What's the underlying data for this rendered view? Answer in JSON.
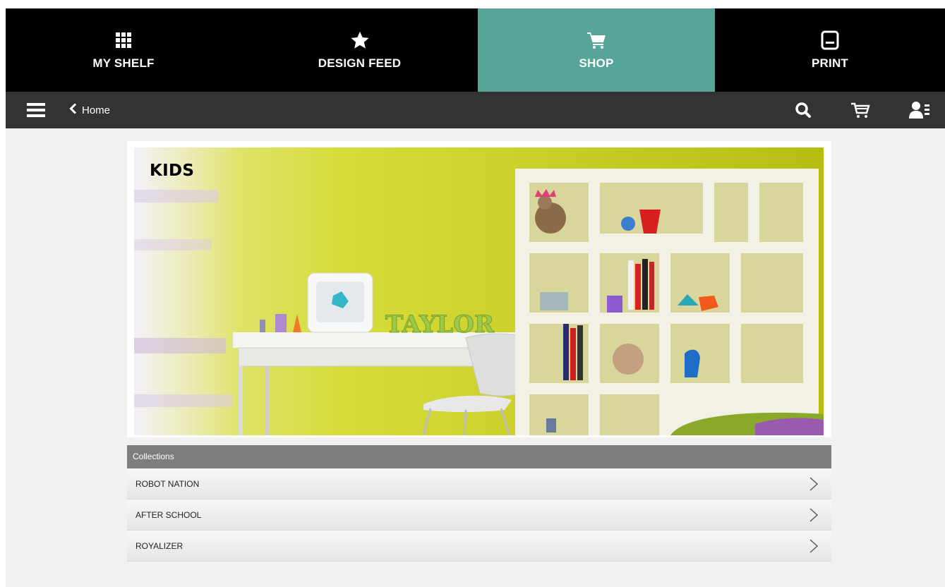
{
  "tabs": [
    {
      "label": "MY SHELF",
      "icon": "grid-icon",
      "active": false
    },
    {
      "label": "DESIGN FEED",
      "icon": "star-icon",
      "active": false
    },
    {
      "label": "SHOP",
      "icon": "cart-icon",
      "active": true
    },
    {
      "label": "PRINT",
      "icon": "printer-icon",
      "active": false
    }
  ],
  "navbar": {
    "back_label": "Home",
    "icons": [
      "hamburger-menu-icon",
      "back-chevron-icon",
      "search-icon",
      "cart-icon",
      "account-icon"
    ]
  },
  "hero": {
    "title": "KIDS",
    "sign_text": "TAYLOR"
  },
  "collections": {
    "header": "Collections",
    "items": [
      {
        "label": "ROBOT NATION"
      },
      {
        "label": "AFTER SCHOOL"
      },
      {
        "label": "ROYALIZER"
      }
    ]
  },
  "colors": {
    "active_tab": "#57a598",
    "tabbar": "#000000",
    "navbar": "#333333",
    "page_bg": "#f1f1f1",
    "collections_header": "#7d7d7d"
  }
}
